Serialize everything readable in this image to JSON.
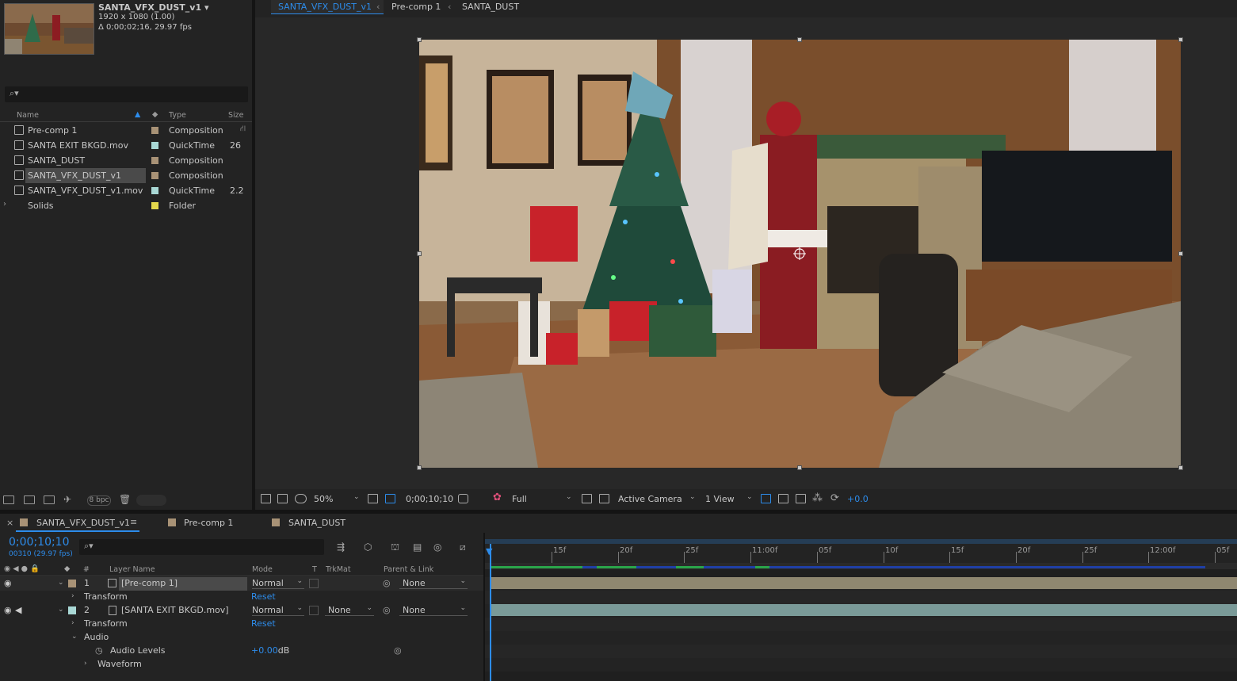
{
  "project": {
    "comp_name": "SANTA_VFX_DUST_v1",
    "comp_size": "1920 x 1080 (1.00)",
    "comp_duration": "Δ 0;00;02;16, 29.97 fps",
    "columns": {
      "name": "Name",
      "type": "Type",
      "size": "Size"
    },
    "items": [
      {
        "name": "Pre-comp 1",
        "type": "Composition",
        "size": "",
        "swatch": "#a89276",
        "icon": "composition-icon"
      },
      {
        "name": "SANTA EXIT BKGD.mov",
        "type": "QuickTime",
        "size": "26",
        "swatch": "#a9d8d5",
        "icon": "footage-icon"
      },
      {
        "name": "SANTA_DUST",
        "type": "Composition",
        "size": "",
        "swatch": "#a89276",
        "icon": "composition-icon"
      },
      {
        "name": "SANTA_VFX_DUST_v1",
        "type": "Composition",
        "size": "",
        "swatch": "#a89276",
        "icon": "composition-icon",
        "selected": true
      },
      {
        "name": "SANTA_VFX_DUST_v1.mov",
        "type": "QuickTime",
        "size": "2.2",
        "swatch": "#a9d8d5",
        "icon": "footage-icon"
      },
      {
        "name": "Solids",
        "type": "Folder",
        "size": "",
        "swatch": "#e4d84c",
        "icon": "folder-icon"
      }
    ],
    "bpc": "8 bpc"
  },
  "viewer": {
    "breadcrumbs": [
      "SANTA_VFX_DUST_v1",
      "Pre-comp 1",
      "SANTA_DUST"
    ],
    "zoom": "50%",
    "timecode": "0;00;10;10",
    "resolution": "Full",
    "camera": "Active Camera",
    "views": "1 View",
    "exposure": "+0.0"
  },
  "timeline": {
    "tabs": [
      "SANTA_VFX_DUST_v1",
      "Pre-comp 1",
      "SANTA_DUST"
    ],
    "tab_swatches": [
      "#a89276",
      "#a89276",
      "#a89276"
    ],
    "timecode": "0;00;10;10",
    "timecode_sub": "00310 (29.97 fps)",
    "columns": {
      "num": "#",
      "layer_name": "Layer Name",
      "mode": "Mode",
      "t": "T",
      "trkmat": "TrkMat",
      "parent": "Parent & Link"
    },
    "ruler": [
      "15f",
      "20f",
      "25f",
      "11:00f",
      "05f",
      "10f",
      "15f",
      "20f",
      "25f",
      "12:00f",
      "05f"
    ],
    "layers": [
      {
        "num": "1",
        "name": "[Pre-comp 1]",
        "mode": "Normal",
        "trkmat": "",
        "parent": "None",
        "color": "#a89276"
      },
      {
        "num": "2",
        "name": "[SANTA EXIT BKGD.mov]",
        "mode": "Normal",
        "trkmat": "None",
        "parent": "None",
        "color": "#a9d8d5"
      }
    ],
    "transform_label": "Transform",
    "reset_label": "Reset",
    "audio_label": "Audio",
    "audio_levels_label": "Audio Levels",
    "audio_levels_value": "+0.00",
    "audio_levels_unit": "dB",
    "waveform_label": "Waveform"
  },
  "colors": {
    "accent": "#2d8ceb",
    "precomp_track": "#8f8770",
    "footage_track": "#7a9a98"
  }
}
